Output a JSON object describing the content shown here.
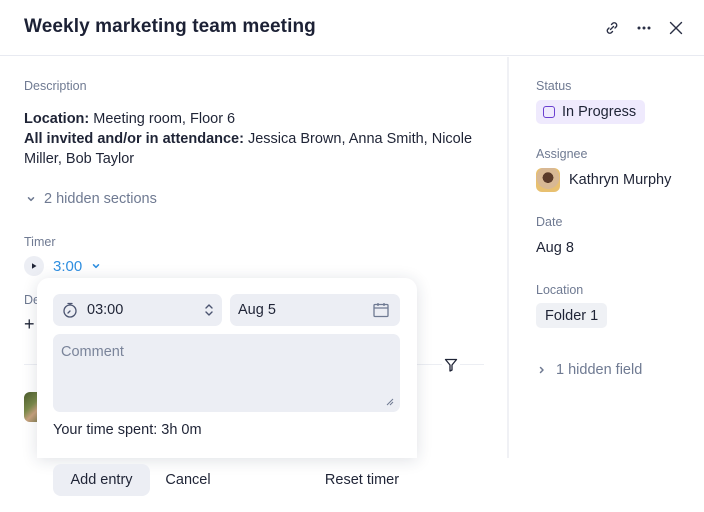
{
  "header": {
    "title": "Weekly marketing team meeting",
    "icons": [
      "link-icon",
      "more-icon",
      "close-icon"
    ]
  },
  "description": {
    "label": "Description",
    "location_label": "Location:",
    "location_value": " Meeting room, Floor 6",
    "attendance_label": "All invited and/or in attendance:",
    "attendance_value": " Jessica Brown, Anna Smith, Nicole Miller, Bob Taylor"
  },
  "hidden_sections": "2 hidden sections",
  "timer": {
    "label": "Timer",
    "value": "3:00"
  },
  "partial_label": "De",
  "popover": {
    "time_value": "03:00",
    "date_value": "Aug 5",
    "comment_placeholder": "Comment",
    "comment_value": "",
    "time_spent": "Your time spent: 3h 0m",
    "add_entry_label": "Add entry",
    "cancel_label": "Cancel",
    "reset_label": "Reset timer"
  },
  "sidebar": {
    "status_label": "Status",
    "status_value": "In Progress",
    "status_color": "#6a3fd0",
    "assignee_label": "Assignee",
    "assignee_name": "Kathryn Murphy",
    "date_label": "Date",
    "date_value": "Aug 8",
    "location_label": "Location",
    "location_value": "Folder 1",
    "hidden_field": "1 hidden field"
  },
  "colors": {
    "accent": "#2f8fe0",
    "muted_text": "#6f7a92",
    "field_bg": "#eceef4"
  }
}
